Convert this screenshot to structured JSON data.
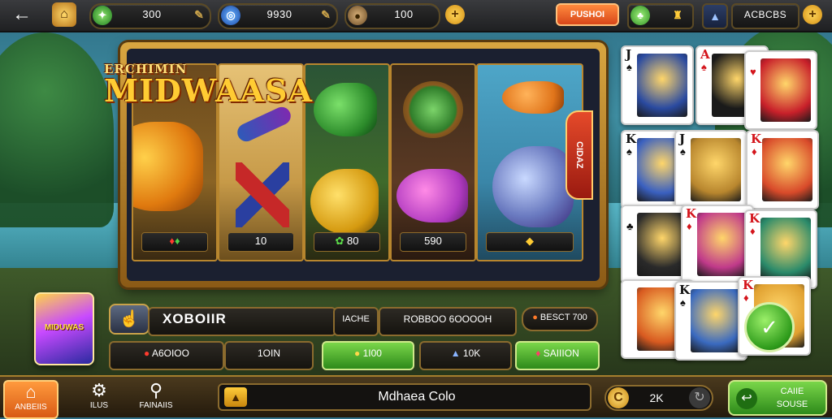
{
  "topbar": {
    "back_label": "←",
    "gem_value": "300",
    "chip_value": "9930",
    "coin_value": "100",
    "promo_button": "PUSHOI",
    "label_right": "ACBCBS",
    "plus": "+"
  },
  "logo": {
    "line1": "ERCHIMIN",
    "line2": "MIDWAASA"
  },
  "reels": [
    {
      "value": "",
      "icon": "gem-icon"
    },
    {
      "value": "10",
      "icon": ""
    },
    {
      "value": "80",
      "icon": "clover-icon"
    },
    {
      "value": "590",
      "icon": ""
    },
    {
      "value": "",
      "icon": "diamond-icon"
    }
  ],
  "cards": [
    {
      "rank": "J",
      "suit": "♠",
      "color": "black"
    },
    {
      "rank": "A",
      "suit": "♠",
      "color": "red"
    },
    {
      "rank": "",
      "suit": "♥",
      "color": "red"
    },
    {
      "rank": "K",
      "suit": "♠",
      "color": "black"
    },
    {
      "rank": "J",
      "suit": "♠",
      "color": "black"
    },
    {
      "rank": "K",
      "suit": "♦",
      "color": "red"
    },
    {
      "rank": "",
      "suit": "♣",
      "color": "black"
    },
    {
      "rank": "K",
      "suit": "♦",
      "color": "red"
    },
    {
      "rank": "K",
      "suit": "♦",
      "color": "red"
    },
    {
      "rank": "",
      "suit": "",
      "color": "red"
    },
    {
      "rank": "K",
      "suit": "♠",
      "color": "black"
    },
    {
      "rank": "K",
      "suit": "♦",
      "color": "red"
    }
  ],
  "product": {
    "label": "MIDUWAS"
  },
  "controls": {
    "row1": {
      "title": "XOBOIIR",
      "bet_label": "IACHE",
      "bet_value": "ROBBOO 6OOOOH",
      "right_pill": "BESCT 700"
    },
    "row2": {
      "value_a": "A6OIOO",
      "value_b": "1OIN",
      "green_a": "1I00",
      "value_c": "10K",
      "green_b": "SAIIION"
    }
  },
  "bottom_bar": {
    "home": "ANBEIIS",
    "settings": "ILUS",
    "search": "FAINAIIS",
    "center_text": "Mdhaea Colo",
    "coin_count": "2K",
    "game_button_line1": "CAIIE",
    "game_button_line2": "SOUSE"
  },
  "side_tag": "CIDAZ"
}
